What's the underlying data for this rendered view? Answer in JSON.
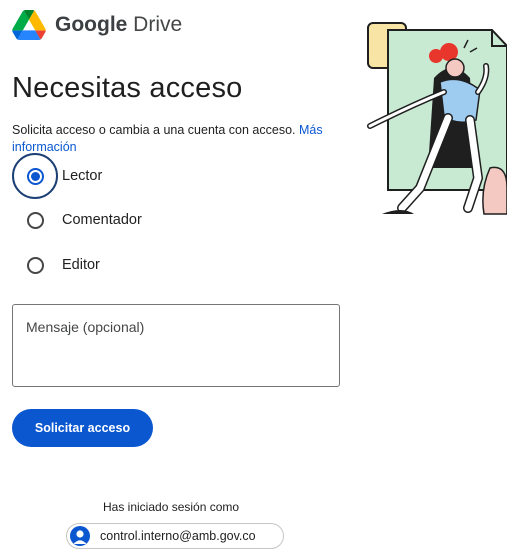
{
  "brand": {
    "logo_icon": "google-drive-logo-icon",
    "name_bold": "Google",
    "name_rest": " Drive"
  },
  "page": {
    "title": "Necesitas acceso",
    "description": "Solicita acceso o cambia a una cuenta con acceso.",
    "more_info_link": "Más información"
  },
  "roles": {
    "selected": "Lector",
    "options": [
      {
        "label": "Lector",
        "selected": true
      },
      {
        "label": "Comentador",
        "selected": false
      },
      {
        "label": "Editor",
        "selected": false
      }
    ]
  },
  "message": {
    "placeholder": "Mensaje (opcional)",
    "value": ""
  },
  "request_button": {
    "label": "Solicitar acceso"
  },
  "account": {
    "signed_in_label": "Has iniciado sesión como",
    "email": "control.interno@amb.gov.co",
    "avatar_icon": "person-avatar-icon"
  },
  "colors": {
    "primary": "#0b57d0",
    "focus_ring": "#1c3f75",
    "illustration_green": "#c8ead3",
    "illustration_yellow": "#f8e4a4",
    "illustration_pink": "#f4c9c1",
    "illustration_red": "#e8362c"
  }
}
